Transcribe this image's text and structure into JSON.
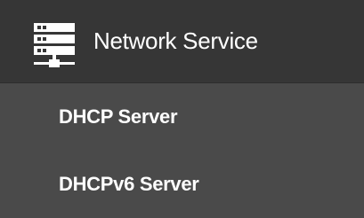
{
  "menu": {
    "header": {
      "label": "Network Service",
      "icon": "server-rack-icon"
    },
    "items": [
      {
        "label": "DHCP Server"
      },
      {
        "label": "DHCPv6 Server"
      }
    ]
  },
  "colors": {
    "header_background": "#363636",
    "menu_background": "#4a4a4a",
    "text": "#ffffff"
  }
}
